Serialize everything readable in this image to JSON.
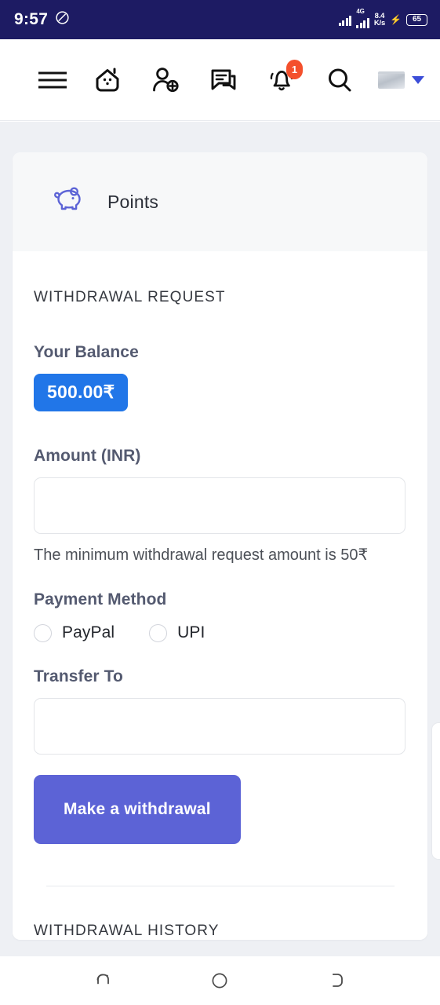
{
  "status_bar": {
    "time": "9:57",
    "dnd_icon": "do-not-disturb-icon",
    "network_type": "4G",
    "net_speed_value": "8.4",
    "net_speed_unit": "K/s",
    "charging_icon": "charging-bolt-icon",
    "battery_percent": "65",
    "background_color": "#1d1b63"
  },
  "nav_bar": {
    "items": [
      {
        "name": "menu-icon",
        "label": "Menu"
      },
      {
        "name": "home-icon",
        "label": "Home"
      },
      {
        "name": "add-friend-icon",
        "label": "Add Friend"
      },
      {
        "name": "messages-icon",
        "label": "Messages"
      },
      {
        "name": "notifications-icon",
        "label": "Notifications"
      },
      {
        "name": "search-icon",
        "label": "Search"
      }
    ],
    "notification_badge": "1",
    "badge_color": "#f4502c",
    "avatar_label": "User avatar",
    "caret_label": "Account menu"
  },
  "card": {
    "header_title": "Points",
    "header_icon": "piggy-bank-icon",
    "accent_color": "#5c63d6"
  },
  "form": {
    "section_caption": "WITHDRAWAL REQUEST",
    "balance_label": "Your Balance",
    "balance_value": "500.00₹",
    "balance_badge_color": "#2176e8",
    "amount_label": "Amount (INR)",
    "amount_value": "",
    "amount_placeholder": "",
    "amount_helper": "The minimum withdrawal request amount is 50₹",
    "payment_method_label": "Payment Method",
    "payment_options": [
      {
        "label": "PayPal",
        "selected": false
      },
      {
        "label": "UPI",
        "selected": false
      }
    ],
    "transfer_to_label": "Transfer To",
    "transfer_to_value": "",
    "transfer_to_placeholder": "",
    "submit_label": "Make a withdrawal"
  },
  "history": {
    "caption": "WITHDRAWAL HISTORY"
  },
  "android_nav": {
    "back_label": "Back",
    "home_label": "Home",
    "recents_label": "Recent apps"
  }
}
